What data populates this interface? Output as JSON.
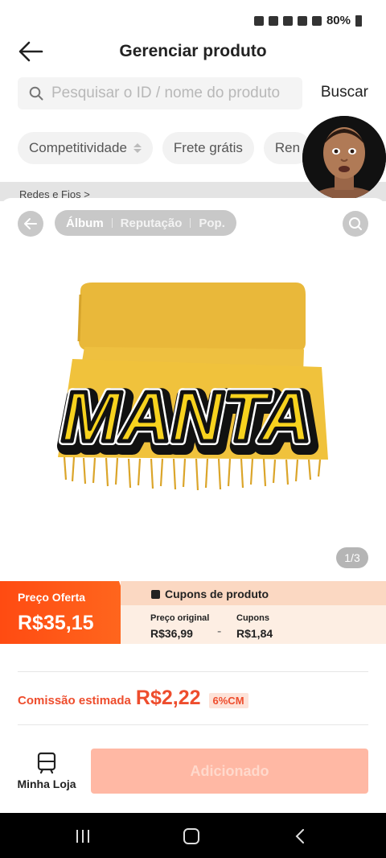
{
  "status_bar": {
    "battery": "80%"
  },
  "header": {
    "title": "Gerenciar produto"
  },
  "search": {
    "placeholder": "Pesquisar o ID / nome do produto",
    "button": "Buscar"
  },
  "filters": [
    "Competitividade",
    "Frete grátis",
    "Ren"
  ],
  "band": {
    "text": "Redes e Fios >"
  },
  "sheet": {
    "tabs": [
      "Álbum",
      "Reputação",
      "Pop."
    ],
    "active_tab": "Álbum",
    "image_caption": "MANTA",
    "page_counter": "1/3"
  },
  "price": {
    "offer_label": "Preço Oferta",
    "offer_value": "R$35,15",
    "coupons_title": "Cupons de produto",
    "original_label": "Preço original",
    "original_value": "R$36,99",
    "minus": "-",
    "coupons_label": "Cupons",
    "coupons_value": "R$1,84"
  },
  "commission": {
    "label": "Comissão estimada",
    "value": "R$2,22",
    "badge": "6%CM"
  },
  "footer": {
    "store_label": "Minha Loja",
    "add_button": "Adicionado"
  },
  "colors": {
    "accent": "#ee4d2d",
    "blanket": "#f1c435"
  }
}
